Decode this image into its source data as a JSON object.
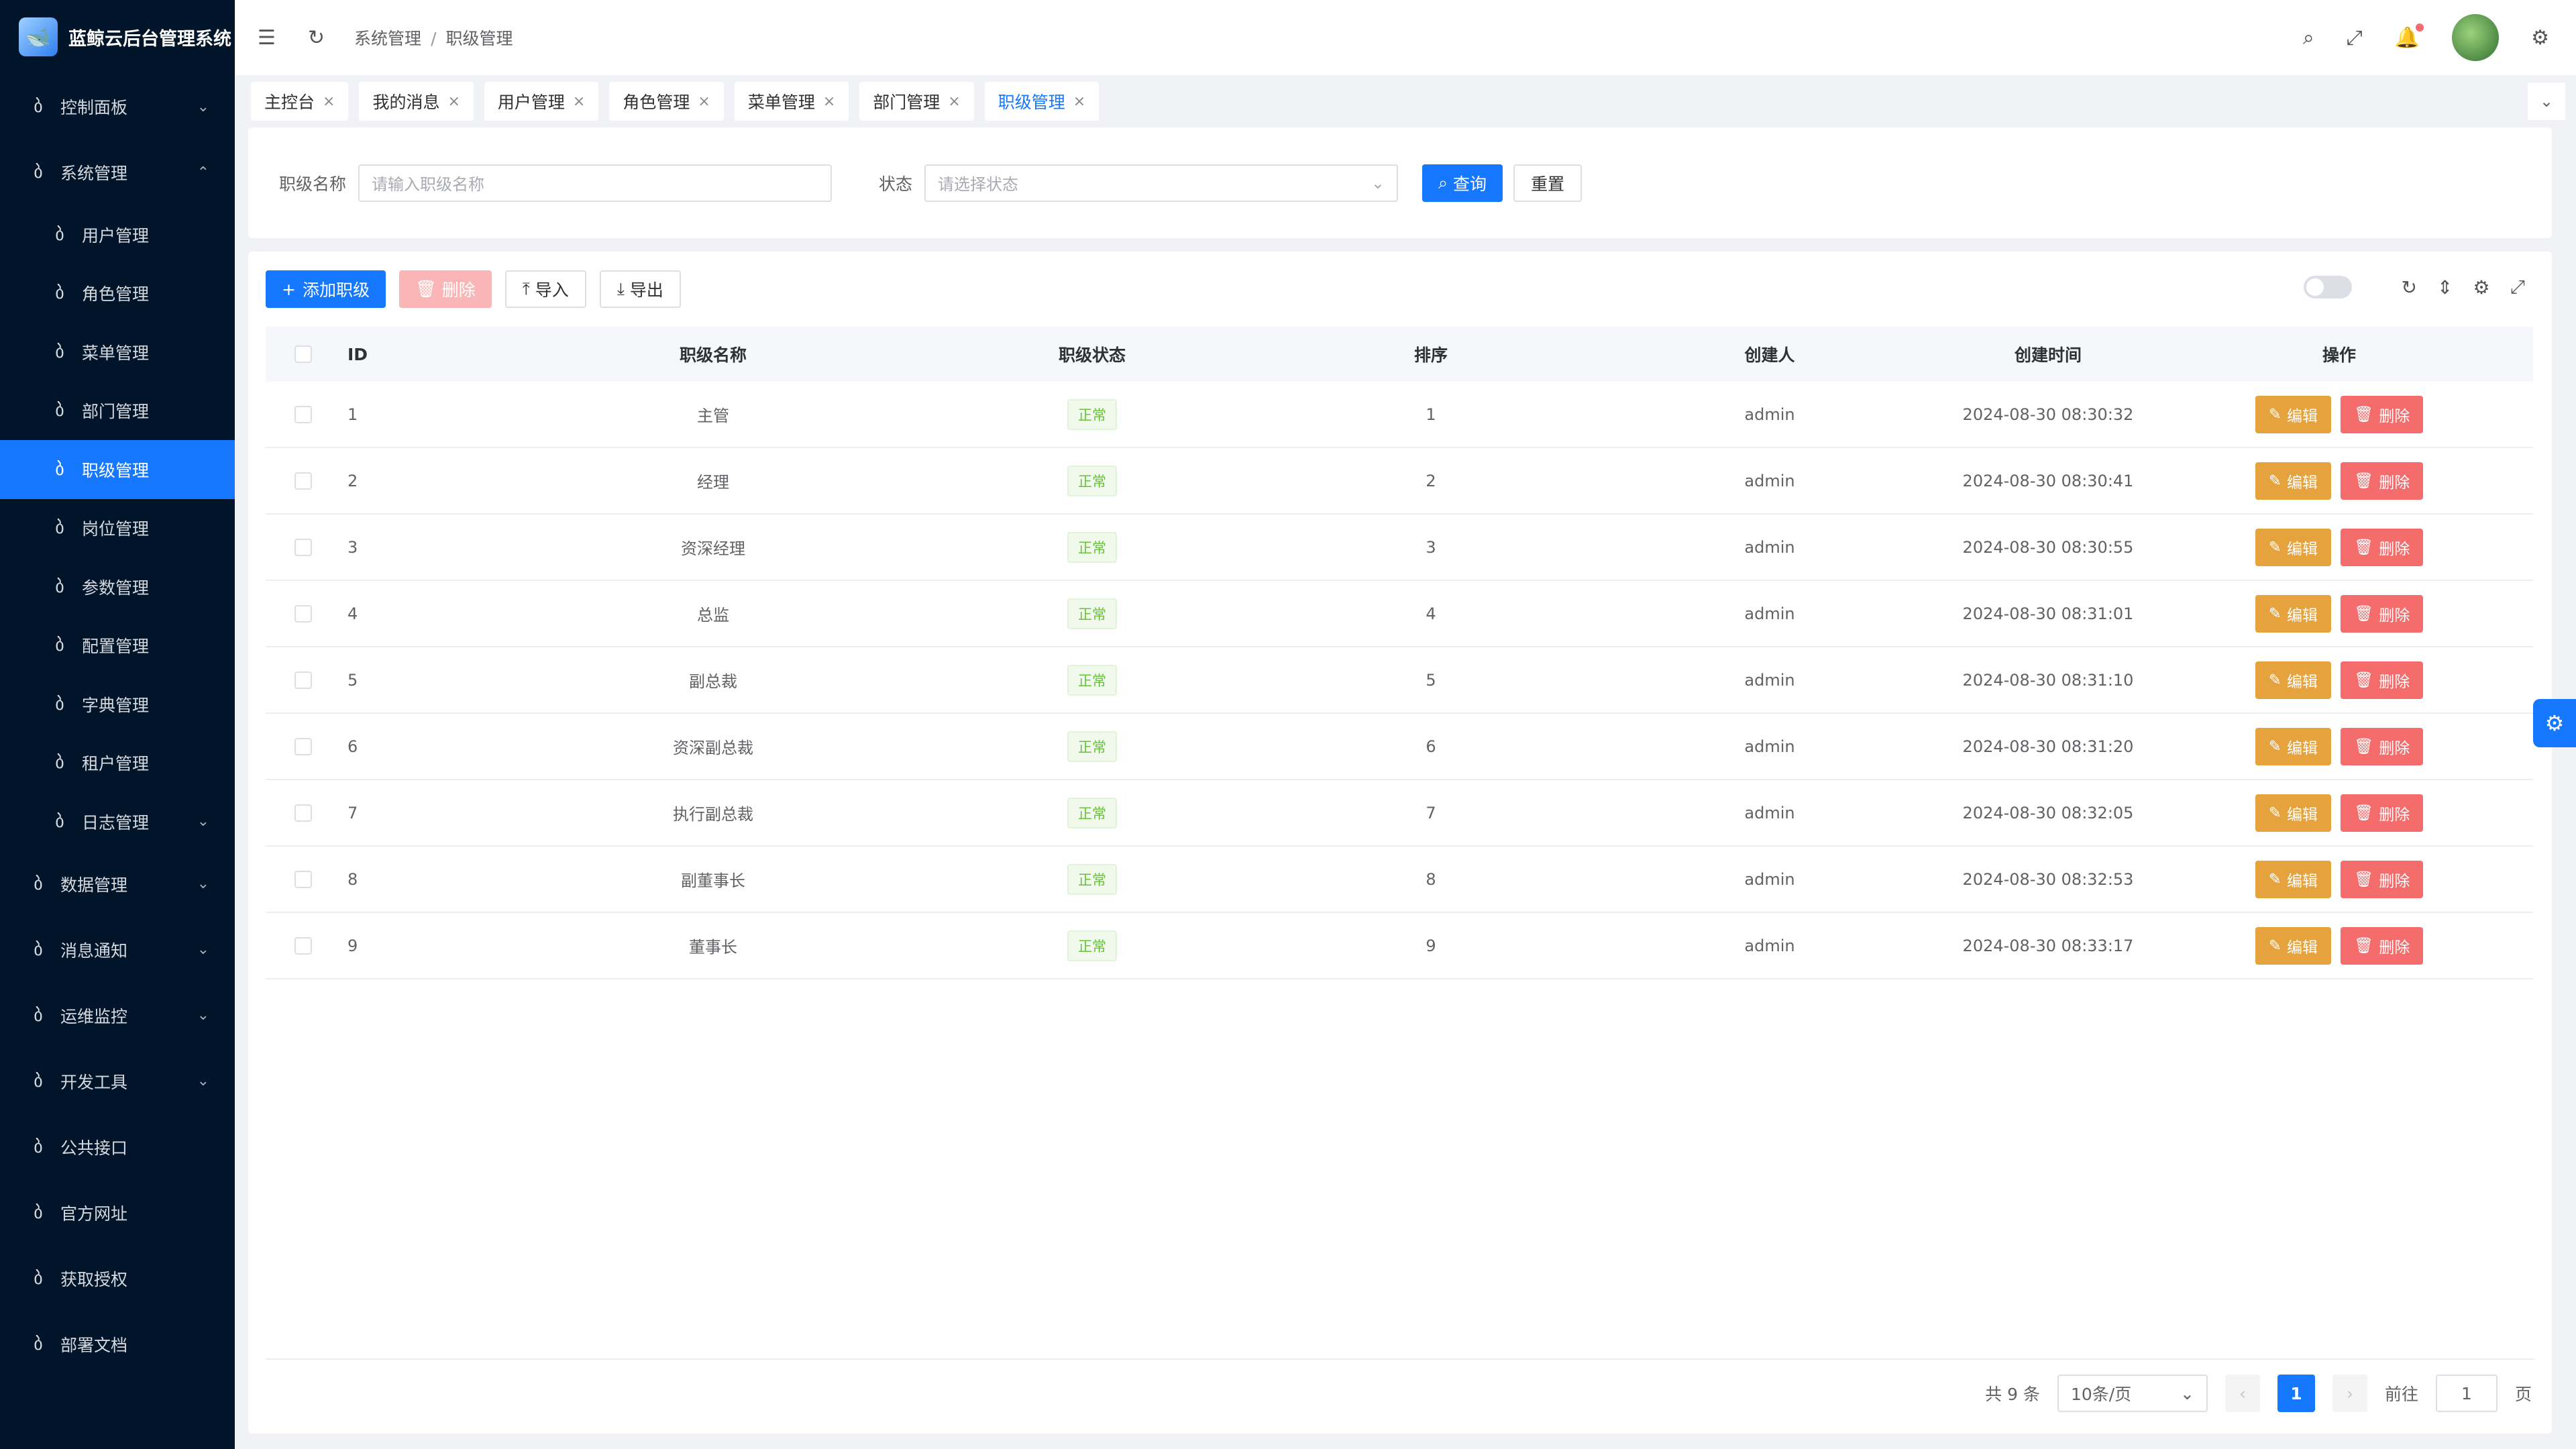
{
  "app": {
    "title": "蓝鲸云后台管理系统",
    "logo_icon": "whale-icon"
  },
  "sidebar": {
    "items": [
      {
        "label": "控制面板",
        "icon": "bike-icon",
        "expanded": false,
        "has_arrow": true
      },
      {
        "label": "系统管理",
        "icon": "bike-icon",
        "expanded": true,
        "has_arrow": true
      },
      {
        "label": "用户管理",
        "icon": "bike-icon",
        "sub": true
      },
      {
        "label": "角色管理",
        "icon": "bike-icon",
        "sub": true
      },
      {
        "label": "菜单管理",
        "icon": "bike-icon",
        "sub": true
      },
      {
        "label": "部门管理",
        "icon": "bike-icon",
        "sub": true
      },
      {
        "label": "职级管理",
        "icon": "bike-icon",
        "sub": true,
        "active": true
      },
      {
        "label": "岗位管理",
        "icon": "bike-icon",
        "sub": true
      },
      {
        "label": "参数管理",
        "icon": "bike-icon",
        "sub": true
      },
      {
        "label": "配置管理",
        "icon": "bike-icon",
        "sub": true
      },
      {
        "label": "字典管理",
        "icon": "bike-icon",
        "sub": true
      },
      {
        "label": "租户管理",
        "icon": "bike-icon",
        "sub": true
      },
      {
        "label": "日志管理",
        "icon": "bike-icon",
        "sub": true,
        "has_arrow": true
      },
      {
        "label": "数据管理",
        "icon": "bike-icon",
        "has_arrow": true
      },
      {
        "label": "消息通知",
        "icon": "bike-icon",
        "has_arrow": true
      },
      {
        "label": "运维监控",
        "icon": "bike-icon",
        "has_arrow": true
      },
      {
        "label": "开发工具",
        "icon": "bike-icon",
        "has_arrow": true
      },
      {
        "label": "公共接口",
        "icon": "bike-icon"
      },
      {
        "label": "官方网址",
        "icon": "bike-icon"
      },
      {
        "label": "获取授权",
        "icon": "bike-icon"
      },
      {
        "label": "部署文档",
        "icon": "bike-icon"
      }
    ]
  },
  "header": {
    "breadcrumb": [
      "系统管理",
      "职级管理"
    ],
    "breadcrumb_sep": "/"
  },
  "tabs": [
    {
      "label": "主控台"
    },
    {
      "label": "我的消息"
    },
    {
      "label": "用户管理"
    },
    {
      "label": "角色管理"
    },
    {
      "label": "菜单管理"
    },
    {
      "label": "部门管理"
    },
    {
      "label": "职级管理",
      "active": true
    }
  ],
  "tab_close": "×",
  "search": {
    "name_label": "职级名称",
    "name_placeholder": "请输入职级名称",
    "status_label": "状态",
    "status_placeholder": "请选择状态",
    "query_button": "查询",
    "reset_button": "重置"
  },
  "toolbar": {
    "add_button": "添加职级",
    "delete_button": "删除",
    "import_button": "导入",
    "export_button": "导出"
  },
  "table": {
    "columns": [
      "ID",
      "职级名称",
      "职级状态",
      "排序",
      "创建人",
      "创建时间",
      "操作"
    ],
    "edit_label": "编辑",
    "delete_label": "删除",
    "rows": [
      {
        "id": "1",
        "name": "主管",
        "status": "正常",
        "sort": "1",
        "creator": "admin",
        "time": "2024-08-30 08:30:32"
      },
      {
        "id": "2",
        "name": "经理",
        "status": "正常",
        "sort": "2",
        "creator": "admin",
        "time": "2024-08-30 08:30:41"
      },
      {
        "id": "3",
        "name": "资深经理",
        "status": "正常",
        "sort": "3",
        "creator": "admin",
        "time": "2024-08-30 08:30:55"
      },
      {
        "id": "4",
        "name": "总监",
        "status": "正常",
        "sort": "4",
        "creator": "admin",
        "time": "2024-08-30 08:31:01"
      },
      {
        "id": "5",
        "name": "副总裁",
        "status": "正常",
        "sort": "5",
        "creator": "admin",
        "time": "2024-08-30 08:31:10"
      },
      {
        "id": "6",
        "name": "资深副总裁",
        "status": "正常",
        "sort": "6",
        "creator": "admin",
        "time": "2024-08-30 08:31:20"
      },
      {
        "id": "7",
        "name": "执行副总裁",
        "status": "正常",
        "sort": "7",
        "creator": "admin",
        "time": "2024-08-30 08:32:05"
      },
      {
        "id": "8",
        "name": "副董事长",
        "status": "正常",
        "sort": "8",
        "creator": "admin",
        "time": "2024-08-30 08:32:53"
      },
      {
        "id": "9",
        "name": "董事长",
        "status": "正常",
        "sort": "9",
        "creator": "admin",
        "time": "2024-08-30 08:33:17"
      }
    ]
  },
  "pagination": {
    "total": "共 9 条",
    "page_size": "10条/页",
    "current_page": "1",
    "goto_label": "前往",
    "goto_value": "1",
    "page_suffix": "页"
  },
  "colors": {
    "primary": "#1677ff",
    "sidebar_bg": "#001529",
    "warning": "#e6a23c",
    "danger": "#f56c6c",
    "success": "#67c23a"
  }
}
